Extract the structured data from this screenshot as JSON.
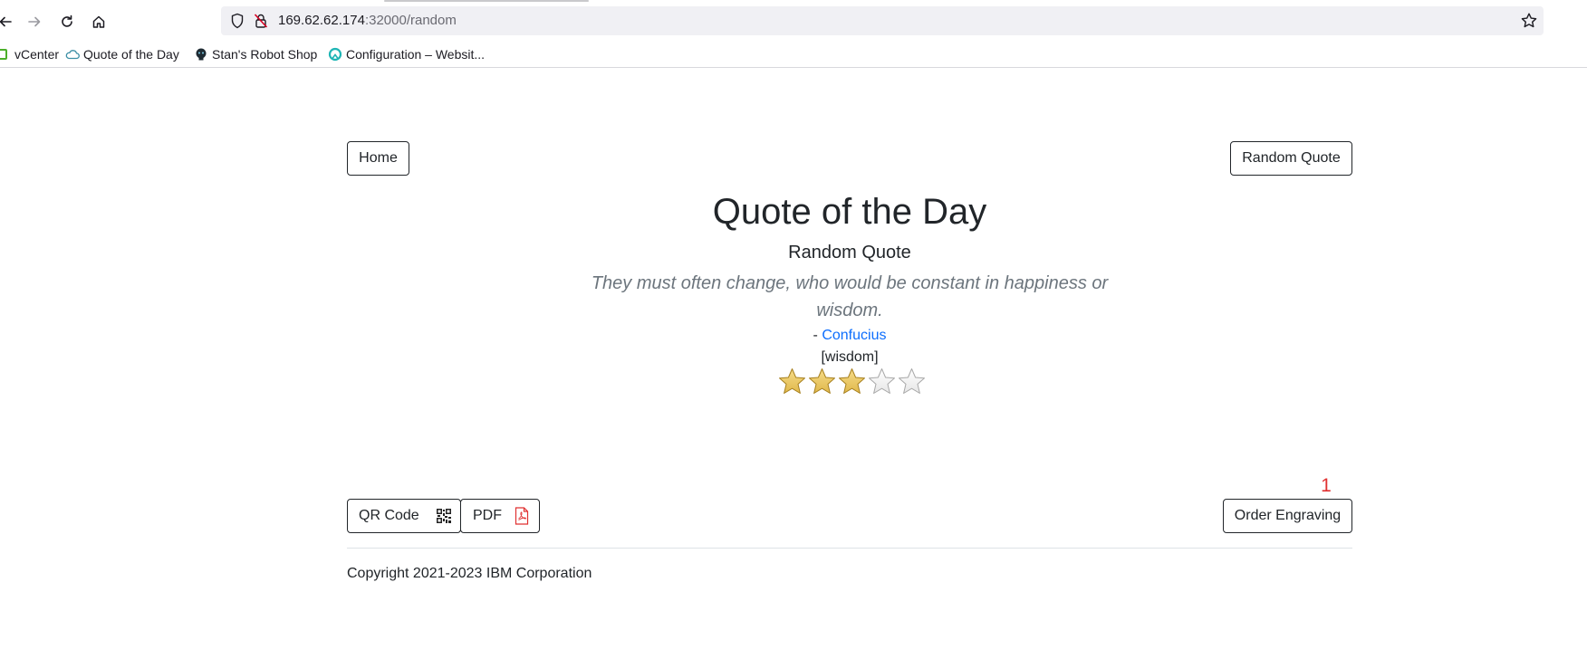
{
  "browser": {
    "url_host": "169.62.62.174",
    "url_path": ":32000/random",
    "bookmarks": [
      {
        "label": "vCenter",
        "icon": "vcenter-icon"
      },
      {
        "label": "Quote of the Day",
        "icon": "cloud-icon"
      },
      {
        "label": "Stan's Robot Shop",
        "icon": "robot-icon"
      },
      {
        "label": "Configuration – Websit...",
        "icon": "config-icon"
      }
    ]
  },
  "page": {
    "home_label": "Home",
    "random_quote_label": "Random Quote",
    "title": "Quote of the Day",
    "subtitle": "Random Quote",
    "quote_text": "They must often change, who would be constant in happiness or wisdom.",
    "author_prefix": "- ",
    "author": "Confucius",
    "tags": "[wisdom]",
    "rating": 3,
    "rating_max": 5,
    "qr_label": "QR Code",
    "pdf_label": "PDF",
    "order_label": "Order Engraving",
    "order_badge": "1",
    "copyright": "Copyright 2021-2023 IBM Corporation"
  },
  "colors": {
    "link": "#0d6efd",
    "quote": "#6c757d",
    "badge": "#e03131",
    "star_filled": "#e0b84a",
    "star_empty": "#e6e6e6"
  }
}
